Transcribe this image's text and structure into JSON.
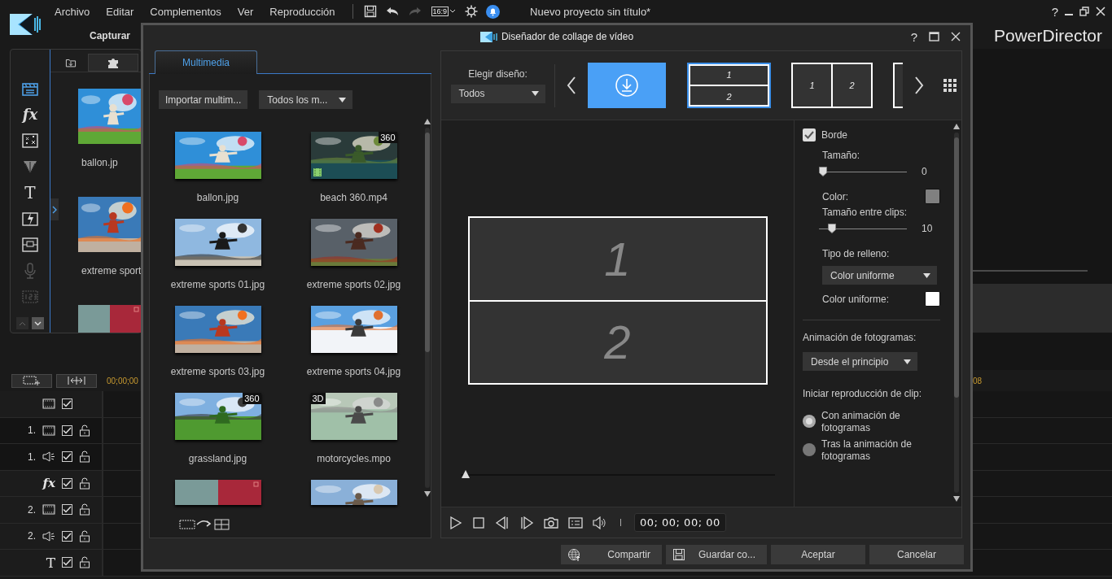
{
  "app": {
    "menu": [
      "Archivo",
      "Editar",
      "Complementos",
      "Ver",
      "Reproducción"
    ],
    "aspect": "16:9",
    "project_title": "Nuevo proyecto sin título*",
    "help": "?",
    "room": "Capturar",
    "product": "PowerDirector"
  },
  "rooms": [
    {
      "kind": "media",
      "selected": true,
      "disabled": false
    },
    {
      "kind": "fx",
      "label": "fx",
      "selected": false,
      "disabled": false
    },
    {
      "kind": "particle",
      "selected": false,
      "disabled": false
    },
    {
      "kind": "spray",
      "selected": false,
      "disabled": false
    },
    {
      "kind": "title",
      "label": "T",
      "selected": false,
      "disabled": false
    },
    {
      "kind": "transition",
      "selected": false,
      "disabled": false
    },
    {
      "kind": "pip",
      "selected": false,
      "disabled": false
    },
    {
      "kind": "mic",
      "selected": false,
      "disabled": true
    },
    {
      "kind": "chapter",
      "selected": false,
      "disabled": true
    }
  ],
  "library": [
    {
      "kind": "clip",
      "name": "ballon.jp"
    },
    {
      "kind": "clip",
      "name": "extreme sport"
    },
    {
      "kind": "cut"
    }
  ],
  "timeline": {
    "timecode": "00;00;00",
    "end_label": "08",
    "tracks": [
      {
        "kind": "master",
        "checked": true
      },
      {
        "kind": "video",
        "number": "1.",
        "checked": true
      },
      {
        "kind": "audio",
        "number": "1.",
        "checked": true
      },
      {
        "kind": "fx",
        "label": "fx",
        "checked": true
      },
      {
        "kind": "video",
        "number": "2.",
        "checked": true
      },
      {
        "kind": "audio",
        "number": "2.",
        "checked": true
      },
      {
        "kind": "title",
        "label": "T",
        "checked": true
      }
    ]
  },
  "dialog": {
    "title": "Diseñador de collage de vídeo",
    "help": "?",
    "tabs": [
      {
        "label": "Multimedia",
        "selected": true
      }
    ],
    "import_button": "Importar multim...",
    "filter": "Todos los m...",
    "media": [
      {
        "kind": "clip",
        "name": "ballon.jpg",
        "video": false
      },
      {
        "kind": "clip",
        "name": "beach 360.mp4",
        "badge": "360",
        "video": true
      },
      {
        "kind": "clip",
        "name": "extreme sports 01.jpg",
        "video": false
      },
      {
        "kind": "clip",
        "name": "extreme sports 02.jpg",
        "video": false
      },
      {
        "kind": "clip",
        "name": "extreme sports 03.jpg",
        "video": false
      },
      {
        "kind": "clip",
        "name": "extreme sports 04.jpg",
        "video": false
      },
      {
        "kind": "clip",
        "name": "grassland.jpg",
        "badge": "360",
        "video": false
      },
      {
        "kind": "clip",
        "name": "motorcycles.mpo",
        "badge": "3D",
        "video": false
      },
      {
        "kind": "cut"
      },
      {
        "kind": "cut"
      }
    ],
    "layout_label": "Elegir diseño:",
    "layout_filter": "Todos",
    "layouts": [
      {
        "kind": "download",
        "selected": false
      },
      {
        "kind": "rows",
        "cells": [
          "1",
          "2"
        ],
        "selected": true
      },
      {
        "kind": "columns",
        "cells": [
          "1",
          "2"
        ],
        "selected": false
      },
      {
        "kind": "partial",
        "selected": false
      }
    ],
    "preview_cells": [
      "1",
      "2"
    ],
    "scrub": {
      "level": 0
    },
    "settings": {
      "border": {
        "label": "Borde",
        "checked": true
      },
      "size": {
        "label": "Tamaño:",
        "level": 0,
        "value": "0"
      },
      "color": {
        "label": "Color:",
        "color": "#808080"
      },
      "gap": {
        "label": "Tamaño entre clips:",
        "level": 0.1,
        "value": "10"
      },
      "fill_type": {
        "label": "Tipo de relleno:",
        "value": "Color uniforme"
      },
      "fill_color": {
        "label": "Color uniforme:",
        "color": "#ffffff"
      },
      "frame_animation": {
        "label": "Animación de fotogramas:",
        "value": "Desde el principio"
      },
      "clip_start": {
        "label": "Iniciar reproducción de clip:",
        "options": [
          {
            "label": "Con animación de fotogramas",
            "selected": true
          },
          {
            "label": "Tras la animación de fotogramas",
            "selected": false
          }
        ]
      }
    },
    "timecode": "00; 00; 00; 00",
    "buttons": [
      {
        "kind": "share",
        "label": "Compartir"
      },
      {
        "kind": "save",
        "label": "Guardar co..."
      },
      {
        "kind": "plain",
        "label": "Aceptar"
      },
      {
        "kind": "plain",
        "label": "Cancelar"
      }
    ]
  }
}
